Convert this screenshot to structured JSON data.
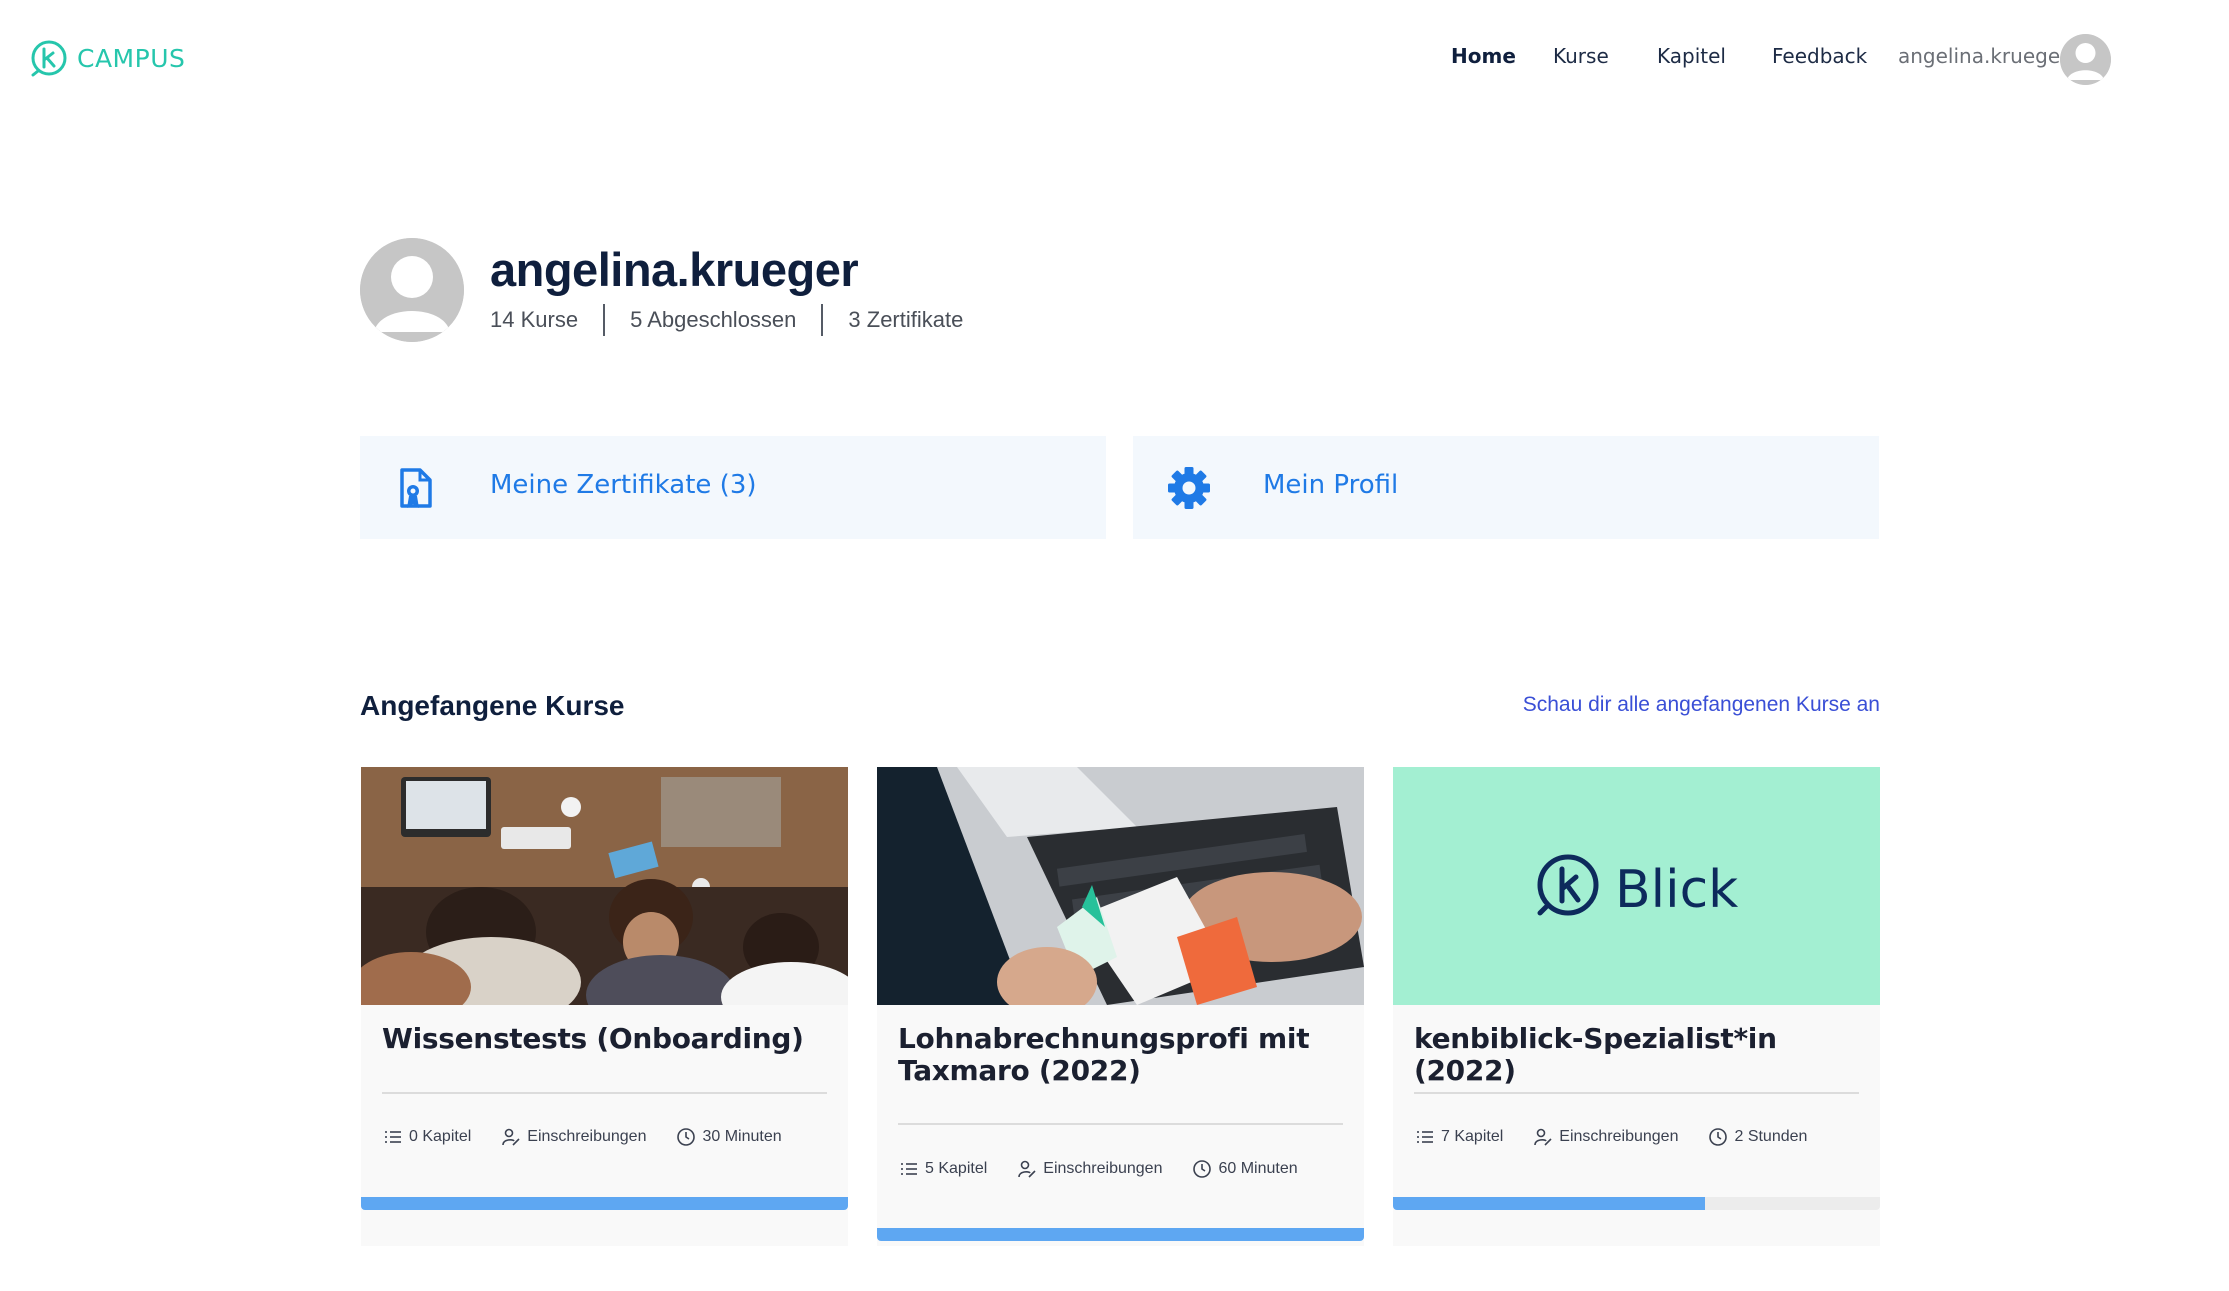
{
  "header": {
    "logo_text": "CAMPUS",
    "nav": [
      {
        "label": "Home",
        "active": true
      },
      {
        "label": "Kurse",
        "active": false
      },
      {
        "label": "Kapitel",
        "active": false
      },
      {
        "label": "Feedback",
        "active": false
      }
    ],
    "username": "angelina.krueger"
  },
  "profile": {
    "name": "angelina.krueger",
    "stats": [
      "14 Kurse",
      "5 Abgeschlossen",
      "3 Zertifikate"
    ]
  },
  "actions": [
    {
      "label": "Meine Zertifikate (3)",
      "icon": "certificate-icon"
    },
    {
      "label": "Mein Profil",
      "icon": "gear-icon"
    }
  ],
  "section": {
    "title": "Angefangene Kurse",
    "link": "Schau dir alle angefangenen Kurse an"
  },
  "courses": [
    {
      "title": "Wissenstests (Onboarding)",
      "chapters": "0 Kapitel",
      "enrollments": "Einschreibungen",
      "duration": "30 Minuten",
      "progress": 1.0,
      "image": "team-photo"
    },
    {
      "title": "Lohnabrechnungsprofi mit Taxmaro (2022)",
      "chapters": "5 Kapitel",
      "enrollments": "Einschreibungen",
      "duration": "60 Minuten",
      "progress": 1.0,
      "image": "laptop-receipt-photo"
    },
    {
      "title": "kenbiblick-Spezialist*in (2022)",
      "chapters": "7 Kapitel",
      "enrollments": "Einschreibungen",
      "duration": "2 Stunden",
      "progress": 0.64,
      "image": "blick-logo",
      "image_text": "Blick"
    }
  ],
  "colors": {
    "brand": "#26c6ac",
    "accent_blue": "#1f7ae6",
    "link_blue": "#3a4fd6",
    "progress": "#5ea7f2",
    "blick_bg": "#a3efd2",
    "navy": "#0f1f3d"
  }
}
